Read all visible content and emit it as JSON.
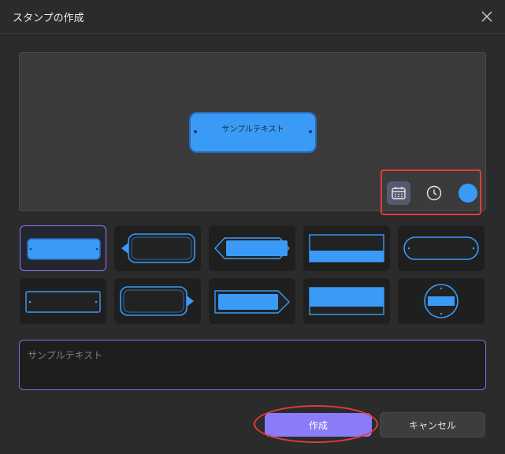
{
  "dialog": {
    "title": "スタンプの作成",
    "close_icon": "close-icon"
  },
  "preview": {
    "sample_text": "サンプルテキスト",
    "stamp_color": "#3a9bf6"
  },
  "tools": {
    "date_icon": "calendar-icon",
    "time_icon": "clock-icon",
    "color_value": "#3a9bf6"
  },
  "stamp_styles": [
    {
      "name": "rounded-rect-filled",
      "selected": true
    },
    {
      "name": "tag-left-arrow"
    },
    {
      "name": "double-arrow-filled"
    },
    {
      "name": "banner-bottom-filled"
    },
    {
      "name": "pill-outline"
    },
    {
      "name": "rect-outline-dots"
    },
    {
      "name": "tag-right-arrow"
    },
    {
      "name": "arrow-right-filled"
    },
    {
      "name": "banner-top-filled"
    },
    {
      "name": "circle-badge"
    }
  ],
  "input": {
    "placeholder": "サンプルテキスト",
    "value": ""
  },
  "buttons": {
    "create_label": "作成",
    "cancel_label": "キャンセル"
  },
  "colors": {
    "accent": "#8a7cf8",
    "stamp_blue": "#3a9bf6",
    "highlight_red": "#e33b3b"
  }
}
